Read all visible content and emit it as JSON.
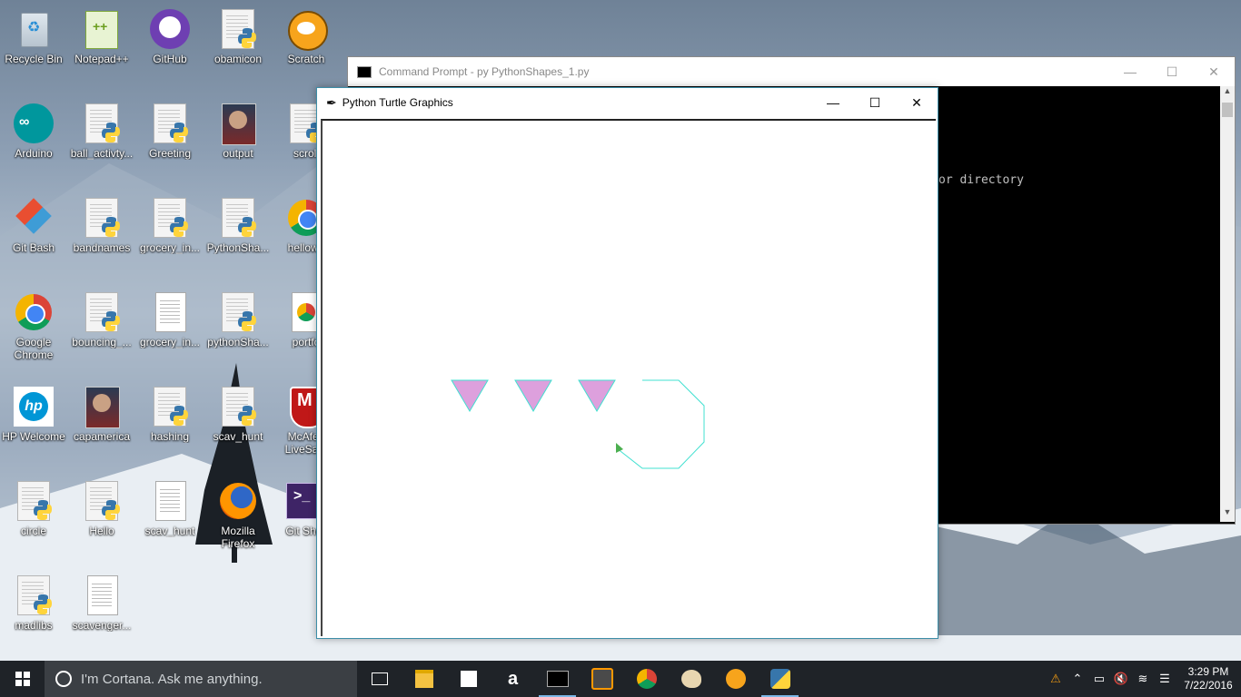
{
  "desktop": {
    "icons": [
      {
        "label": "Recycle Bin",
        "icon": "recycle-bin-icon"
      },
      {
        "label": "Notepad++",
        "icon": "notepadpp-icon"
      },
      {
        "label": "GitHub",
        "icon": "github-icon"
      },
      {
        "label": "obamicon",
        "icon": "python-file-icon"
      },
      {
        "label": "Scratch",
        "icon": "scratch-icon"
      },
      {
        "label": "Arduino",
        "icon": "arduino-icon"
      },
      {
        "label": "ball_activty...",
        "icon": "python-file-icon"
      },
      {
        "label": "Greeting",
        "icon": "python-file-icon"
      },
      {
        "label": "output",
        "icon": "image-file-icon"
      },
      {
        "label": "scroll",
        "icon": "python-file-icon"
      },
      {
        "label": "Git Bash",
        "icon": "git-bash-icon"
      },
      {
        "label": "bandnames",
        "icon": "python-file-icon"
      },
      {
        "label": "grocery_in...",
        "icon": "python-file-icon"
      },
      {
        "label": "PythonSha...",
        "icon": "python-file-icon"
      },
      {
        "label": "hellowo",
        "icon": "chrome-icon"
      },
      {
        "label": "Google Chrome",
        "icon": "chrome-icon"
      },
      {
        "label": "bouncing_...",
        "icon": "python-file-icon"
      },
      {
        "label": "grocery_in...",
        "icon": "text-file-icon"
      },
      {
        "label": "pythonSha...",
        "icon": "python-file-icon"
      },
      {
        "label": "portfo",
        "icon": "chrome-html-icon"
      },
      {
        "label": "HP Welcome",
        "icon": "hp-icon"
      },
      {
        "label": "capamerica",
        "icon": "image-file-icon"
      },
      {
        "label": "hashing",
        "icon": "python-file-icon"
      },
      {
        "label": "scav_hunt",
        "icon": "python-file-icon"
      },
      {
        "label": "McAfee LiveSafe",
        "icon": "mcafee-icon"
      },
      {
        "label": "circle",
        "icon": "python-file-icon"
      },
      {
        "label": "Hello",
        "icon": "python-file-icon"
      },
      {
        "label": "scav_hunt",
        "icon": "text-file-icon"
      },
      {
        "label": "Mozilla Firefox",
        "icon": "firefox-icon"
      },
      {
        "label": "Git Shell",
        "icon": "git-shell-icon"
      },
      {
        "label": "madlibs",
        "icon": "python-file-icon"
      },
      {
        "label": "scavenger...",
        "icon": "text-file-icon"
      }
    ]
  },
  "cmd_window": {
    "title": "Command Prompt - py  PythonShapes_1.py",
    "output_fragment": "or directory"
  },
  "turtle_window": {
    "title": "Python Turtle Graphics",
    "shapes": {
      "triangle_count": 3,
      "triangle_fill": "#dda0dd",
      "stroke": "#40e0d0",
      "turtle_color": "#4caf50"
    }
  },
  "taskbar": {
    "search_placeholder": "I'm Cortana. Ask me anything.",
    "time": "3:29 PM",
    "date": "7/22/2016",
    "pinned": [
      "task-view-icon",
      "file-explorer-icon",
      "store-icon",
      "amazon-icon",
      "cmd-icon",
      "sublime-icon",
      "chrome-icon",
      "paint-icon",
      "scratch-icon",
      "python-icon"
    ]
  },
  "colors": {
    "taskbar_bg": "#1f2328",
    "accent": "#7bb7e6"
  }
}
